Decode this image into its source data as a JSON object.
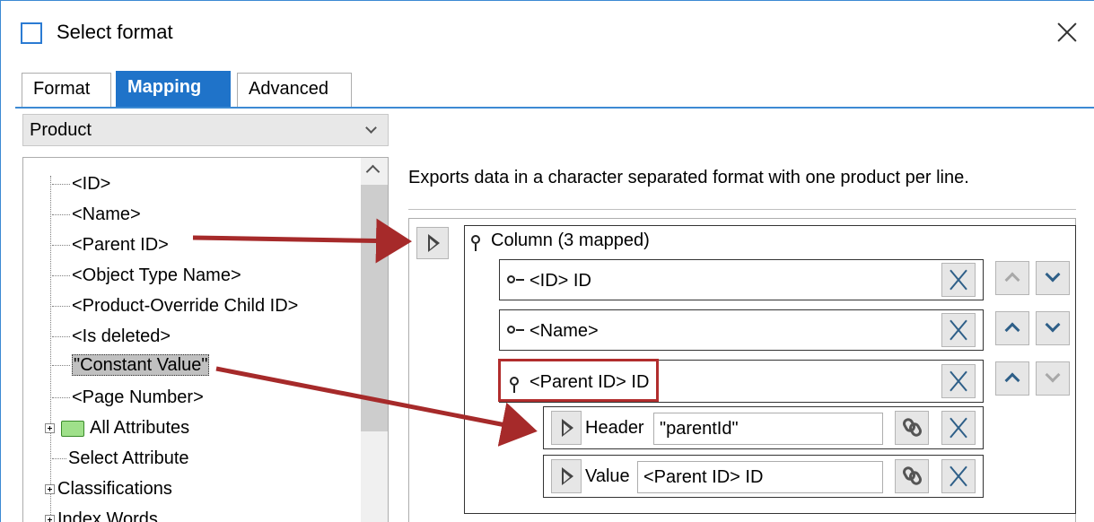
{
  "window": {
    "title": "Select format"
  },
  "tabs": [
    {
      "label": "Format"
    },
    {
      "label": "Mapping"
    },
    {
      "label": "Advanced"
    }
  ],
  "left": {
    "dropdown_value": "Product",
    "tree": [
      {
        "label": "<ID>"
      },
      {
        "label": "<Name>"
      },
      {
        "label": "<Parent ID>"
      },
      {
        "label": "<Object Type Name>"
      },
      {
        "label": "<Product-Override Child ID>"
      },
      {
        "label": "<Is deleted>"
      },
      {
        "label": "\"Constant Value\""
      },
      {
        "label": "<Page Number>"
      },
      {
        "label": "All Attributes"
      },
      {
        "label": "Select Attribute"
      },
      {
        "label": "Classifications"
      },
      {
        "label": "Index Words"
      }
    ]
  },
  "right": {
    "description": "Exports data in a character separated format with one product per line.",
    "column_label": "Column (3 mapped)",
    "rows": [
      {
        "label": "<ID> ID"
      },
      {
        "label": "<Name>"
      },
      {
        "label": "<Parent ID> ID"
      }
    ],
    "sub_rows": [
      {
        "label": "Header",
        "value": "\"parentId\""
      },
      {
        "label": "Value",
        "value": "<Parent ID> ID"
      }
    ]
  },
  "colors": {
    "accent": "#1f73c9",
    "annotation": "#a62a2a"
  }
}
